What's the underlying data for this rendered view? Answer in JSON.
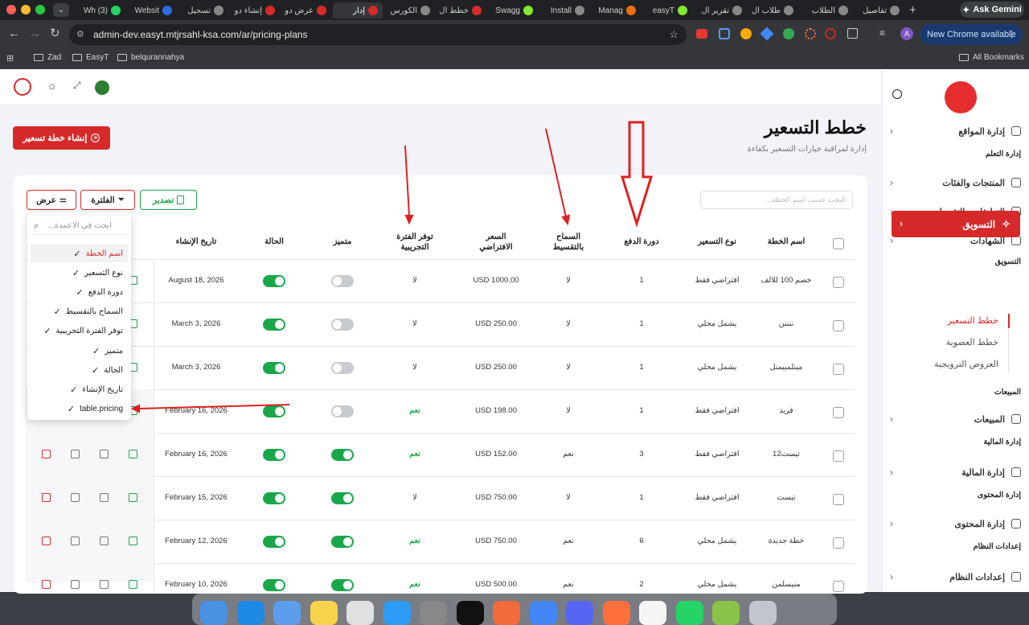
{
  "browser": {
    "tabs": [
      {
        "label": "(3) Wh",
        "color": "#25d366"
      },
      {
        "label": "Websit",
        "color": "#2d6be4"
      },
      {
        "label": "تسجيل",
        "color": "#888"
      },
      {
        "label": "إنشاء دو",
        "color": "#d62a2a"
      },
      {
        "label": "عرض دو",
        "color": "#d62a2a"
      },
      {
        "label": "إدار",
        "color": "#d62a2a"
      },
      {
        "label": "الكورس",
        "color": "#888"
      },
      {
        "label": "خطط ال",
        "color": "#d62a2a"
      },
      {
        "label": "Swagg",
        "color": "#85ea2d"
      },
      {
        "label": "Install",
        "color": "#888"
      },
      {
        "label": "Manag",
        "color": "#e8710a"
      },
      {
        "label": "easyT",
        "color": "#85ea2d"
      },
      {
        "label": "تقرير ال",
        "color": "#888"
      },
      {
        "label": "طلاب ال",
        "color": "#888"
      },
      {
        "label": "الطلاب",
        "color": "#888"
      },
      {
        "label": "تفاصيل",
        "color": "#888"
      }
    ],
    "new_tab": "+",
    "ask_gemini": "Ask Gemini",
    "url": "admin-dev.easyt.mtjrsahl-ksa.com/ar/pricing-plans",
    "new_chrome": "New Chrome available",
    "bookmarks": [
      "Zad",
      "EasyT",
      "belqurannahya"
    ],
    "all_bookmarks": "All Bookmarks"
  },
  "sidebar": {
    "items": [
      {
        "label": "إدارة المواقع",
        "icon": "globe-icon"
      },
      {
        "section": "إدارة التعلم"
      },
      {
        "label": "المنتجات والفئات",
        "icon": "graduation-cap-icon"
      },
      {
        "label": "التعليقات والتقييمات",
        "icon": "comment-icon"
      },
      {
        "label": "الشهادات",
        "icon": "certificate-icon"
      },
      {
        "section": "التسويق"
      },
      {
        "label": "التسويق",
        "icon": "sparkles-icon",
        "active": true
      },
      {
        "section": "المبيعات"
      },
      {
        "label": "المبيعات",
        "icon": "cash-icon"
      },
      {
        "section": "إدارة المالية"
      },
      {
        "label": "إدارة المالية",
        "icon": "chart-icon"
      },
      {
        "section": "إدارة المحتوى"
      },
      {
        "label": "إدارة المحتوى",
        "icon": "document-icon"
      },
      {
        "section": "إعدادات النظام"
      },
      {
        "label": "إعدادات النظام",
        "icon": "gear-icon"
      }
    ],
    "sub_items": [
      "خطط التسعير",
      "خطط العضوية",
      "العروض الترويجية"
    ]
  },
  "page": {
    "title": "خطط التسعير",
    "subtitle": "إدارة لمراقبة خيارات التسعير بكفاءة",
    "create_button": "إنشاء خطة تسعير",
    "search_placeholder": "البحث حسب اسم الخطة...",
    "export_button": "تصدير",
    "filter_button": "الفلترة",
    "view_button": "عرض"
  },
  "table": {
    "headers": [
      "اسم الخطة",
      "نوع التسعير",
      "دورة الدفع",
      "السماح بالتقسيط",
      "السعر الافتراضي",
      "توفر الفترة التجريبية",
      "متميز",
      "الحالة",
      "تاريخ الإنشاء"
    ],
    "rows": [
      {
        "name": "خصم 100 للالف",
        "type": "افتراضي فقط",
        "cycle": "1",
        "installment": "لا",
        "price": "USD 1000.00",
        "trial": "لا",
        "featured": false,
        "status": true,
        "created": "August 18, 2026"
      },
      {
        "name": "ننننن",
        "type": "يشمل محلي",
        "cycle": "1",
        "installment": "لا",
        "price": "USD 250.00",
        "trial": "لا",
        "featured": false,
        "status": true,
        "created": "March 3, 2026"
      },
      {
        "name": "مينلمبيمنل",
        "type": "يشمل محلي",
        "cycle": "1",
        "installment": "لا",
        "price": "USD 250.00",
        "trial": "لا",
        "featured": false,
        "status": true,
        "created": "March 3, 2026"
      },
      {
        "name": "فريد",
        "type": "افتراضي فقط",
        "cycle": "1",
        "installment": "لا",
        "price": "USD 198.00",
        "trial": "نعم",
        "featured": false,
        "status": true,
        "created": "February 16, 2026"
      },
      {
        "name": "تيست12",
        "type": "افتراضي فقط",
        "cycle": "3",
        "installment": "نعم",
        "price": "USD 152.00",
        "trial": "نعم",
        "featured": true,
        "status": true,
        "created": "February 16, 2026"
      },
      {
        "name": "تيست",
        "type": "افتراضي فقط",
        "cycle": "1",
        "installment": "لا",
        "price": "USD 750.00",
        "trial": "لا",
        "featured": true,
        "status": true,
        "created": "February 15, 2026"
      },
      {
        "name": "خطة جديدة",
        "type": "يشمل محلي",
        "cycle": "6",
        "installment": "نعم",
        "price": "USD 750.00",
        "trial": "نعم",
        "featured": true,
        "status": true,
        "created": "February 12, 2026"
      },
      {
        "name": "منيسلمن",
        "type": "يشمل محلي",
        "cycle": "2",
        "installment": "نعم",
        "price": "USD 500.00",
        "trial": "نعم",
        "featured": true,
        "status": true,
        "created": "February 10, 2026"
      }
    ]
  },
  "column_menu": {
    "search_placeholder": "ابحث في الاعمدة...",
    "items": [
      {
        "label": "اسم الخطة",
        "checked": true,
        "highlight": true
      },
      {
        "label": "نوع التسعير",
        "checked": true
      },
      {
        "label": "دورة الدفع",
        "checked": true
      },
      {
        "label": "السماح بالتقسيط",
        "checked": true
      },
      {
        "label": "توفر الفترة التجريبية",
        "checked": true
      },
      {
        "label": "متميز",
        "checked": true
      },
      {
        "label": "الحالة",
        "checked": true
      },
      {
        "label": "تاريخ الإنشاء",
        "checked": true
      },
      {
        "label": "table.pricing",
        "checked": true
      }
    ]
  },
  "colors": {
    "brand_red": "#d62a2a",
    "success_green": "#19a74a",
    "annotation_red": "#e02020"
  }
}
